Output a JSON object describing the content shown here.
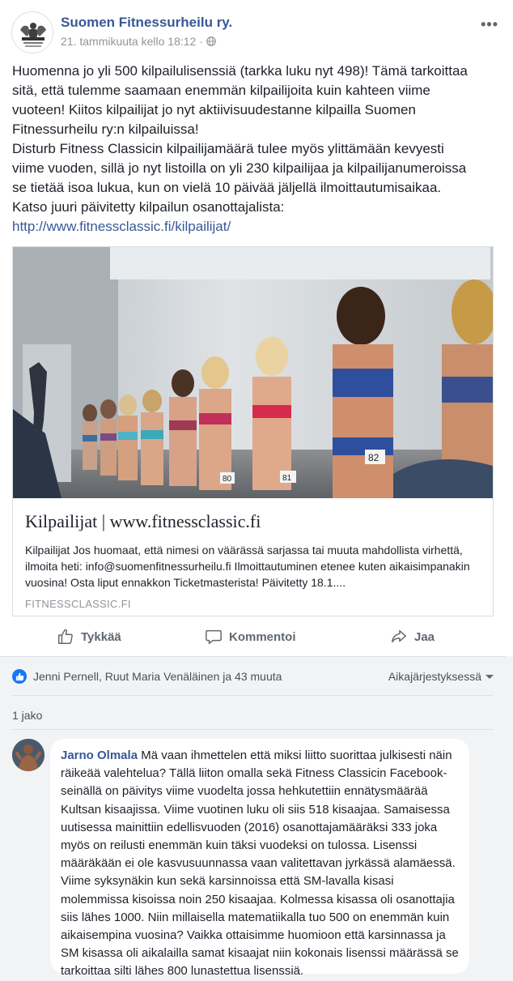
{
  "post": {
    "page_name": "Suomen Fitnessurheilu ry.",
    "timestamp": "21. tammikuuta kello 18:12",
    "separator": "·",
    "more_label": "•••",
    "text_lines": [
      "Huomenna jo yli 500 kilpailulisenssiä (tarkka luku nyt 498)! Tämä tarkoittaa",
      "sitä, että tulemme saamaan enemmän kilpailijoita kuin kahteen viime",
      "vuoteen! Kiitos kilpailijat jo nyt aktiivisuudestanne kilpailla Suomen",
      "Fitnessurheilu ry:n kilpailuissa!",
      "Disturb Fitness Classicin kilpailijamäärä tulee myös ylittämään kevyesti",
      "viime vuoden, sillä jo nyt listoilla on yli 230 kilpailijaa ja kilpailijanumeroissa",
      "se tietää isoa lukua, kun on vielä 10 päivää jäljellä ilmoittautumisaikaa.",
      "Katso juuri päivitetty kilpailun osanottajalista:"
    ],
    "link_url": "http://www.fitnessclassic.fi/kilpailijat/"
  },
  "link_card": {
    "title": "Kilpailijat | www.fitnessclassic.fi",
    "description": "Kilpailijat Jos huomaat, että nimesi on väärässä sarjassa tai muuta mahdollista virhettä, ilmoita heti: info@suomenfitnessurheilu.fi Ilmoittautuminen etenee kuten aikaisimpanakin vuosina! Osta liput ennakkon Ticketmasterista! Päivitetty 18.1....",
    "domain": "FITNESSCLASSIC.FI",
    "bib_numbers": [
      "82",
      "81",
      "80"
    ]
  },
  "actions": {
    "like": "Tykkää",
    "comment": "Kommentoi",
    "share": "Jaa"
  },
  "reactions": {
    "reactors": "Jenni Pernell, Ruut Maria Venäläinen ja 43 muuta",
    "sort_label": "Aikajärjestyksessä",
    "shares": "1 jako"
  },
  "comment": {
    "author": "Jarno Olmala",
    "text": "Mä vaan ihmettelen että miksi liitto suorittaa julkisesti näin räikeää valehtelua? Tällä liiton omalla sekä Fitness Classicin Facebook-seinällä on päivitys viime vuodelta jossa hehkutettiin ennätysmäärää Kultsan kisaajissa. Viime vuotinen luku oli siis 518 kisaajaa. Samaisessa uutisessa mainittiin edellisvuoden (2016) osanottajamääräksi 333 joka myös on reilusti enemmän kuin täksi vuodeksi on tulossa. Lisenssi määräkään ei ole kasvusuunnassa vaan valitettavan jyrkässä alamäessä. Viime syksynäkin kun sekä karsinnoissa että SM-lavalla kisasi molemmissa kisoissa noin 250 kisaajaa. Kolmessa kisassa oli osanottajia siis lähes 1000. Niin millaisella matematiikalla tuo 500 on enemmän kuin aikaisempina vuosina? Vaikka ottaisimme huomioon että karsinnassa ja SM kisassa oli aikalailla samat kisaajat niin kokonais lisenssi määrässä se tarkoittaa silti lähes 800 lunastettua lisenssiä."
  },
  "colors": {
    "link_blue": "#385898",
    "meta_gray": "#90949c",
    "comment_bg": "#f2f3f5",
    "like_blue": "#1877f2"
  }
}
